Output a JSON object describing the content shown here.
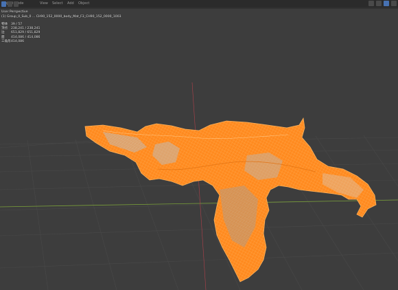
{
  "header": {
    "mode": "Object Mode",
    "menus": [
      "View",
      "Select",
      "Add",
      "Object"
    ]
  },
  "overlay": {
    "view_name": "User Perspective",
    "object_line": "(1) Group_0_Sub_0 ...",
    "object_detail": "CH90_152_0000_body_Mat_F3_CH90_152_0000_1003"
  },
  "stats": [
    {
      "label": "物体",
      "value": "39 / 57"
    },
    {
      "label": "顶点",
      "value": "238,241 / 238,241"
    },
    {
      "label": "边",
      "value": "651,829 / 651,829"
    },
    {
      "label": "面",
      "value": "414,086 / 414,086"
    },
    {
      "label": "三角形",
      "value": "414,086"
    }
  ],
  "colors": {
    "background": "#3d3d3d",
    "mesh_primary": "#ff8a1f",
    "mesh_wire": "#ffb15a",
    "grid_line": "#4a4a4a",
    "axis_red": "#b0414b",
    "axis_green": "#7aa03a"
  },
  "icons": [
    "cursor-icon",
    "box-select-icon",
    "move-icon",
    "overlay-icon",
    "shading-icon"
  ]
}
